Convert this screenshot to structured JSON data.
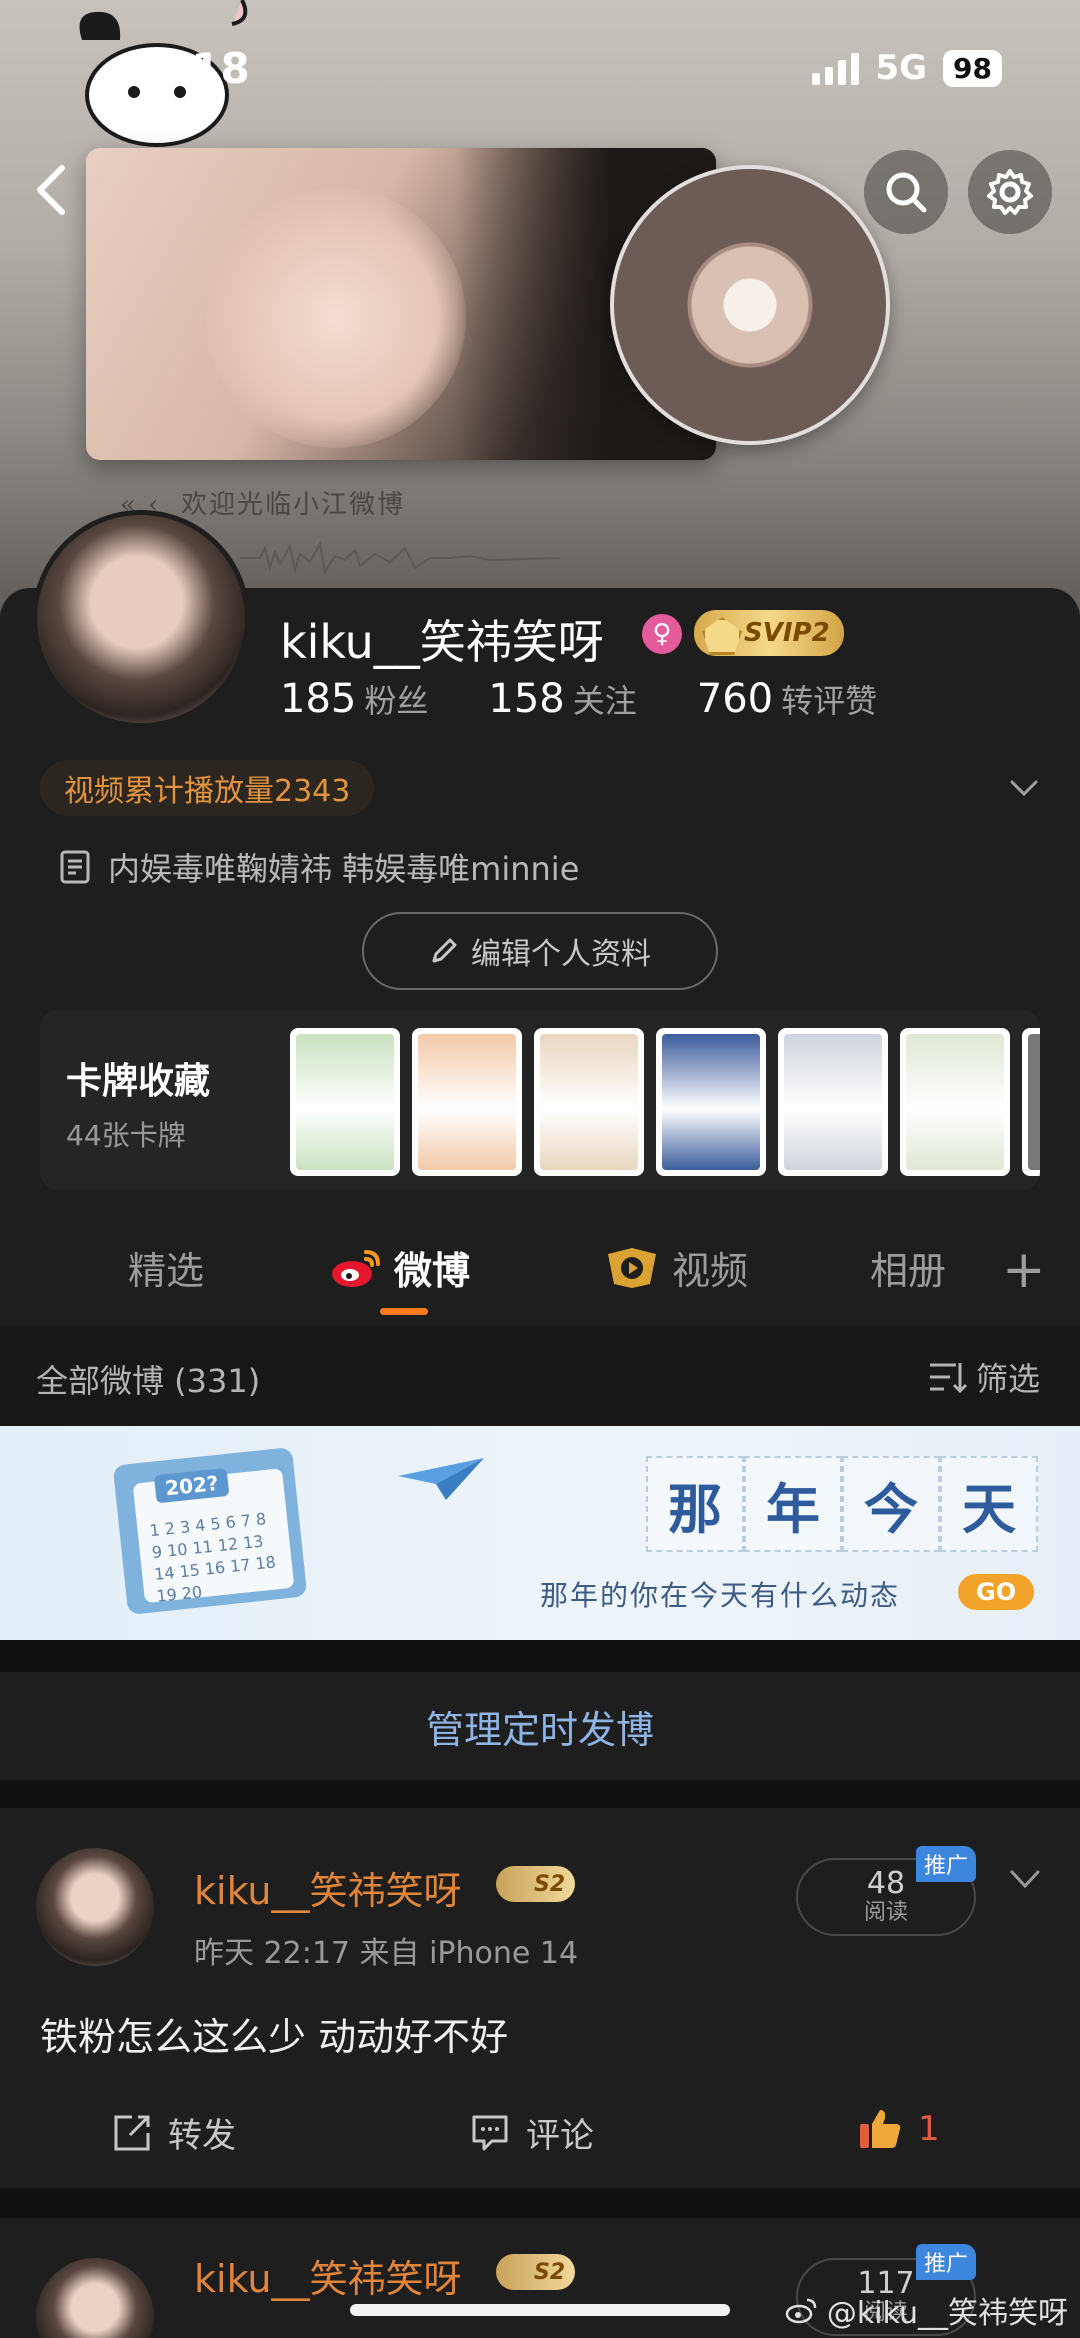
{
  "status_bar": {
    "time": "07:18",
    "network": "5G",
    "battery": "98"
  },
  "cover": {
    "welcome_text": "欢迎光临小江微博",
    "quote_mark": "« ‹"
  },
  "profile": {
    "username": "kiku__笑祎笑呀",
    "gender_symbol": "♀",
    "vip_badge": "SVIP2",
    "stats": [
      {
        "value": "185",
        "label": "粉丝"
      },
      {
        "value": "158",
        "label": "关注"
      },
      {
        "value": "760",
        "label": "转评赞"
      }
    ],
    "video_plays": "视频累计播放量2343",
    "bio": "内娱毒唯鞠婧祎 韩娱毒唯minnie",
    "edit_button": "编辑个人资料"
  },
  "cards": {
    "title": "卡牌收藏",
    "subtitle": "44张卡牌",
    "thumb_colors": [
      "#c9e2c0",
      "#f3c9a8",
      "#e9d6c0",
      "#3b5c9c",
      "#cfd4dc",
      "#dfe8d6"
    ]
  },
  "tabs": [
    {
      "label": "精选",
      "active": false
    },
    {
      "label": "微博",
      "active": true
    },
    {
      "label": "视频",
      "active": false
    },
    {
      "label": "相册",
      "active": false
    }
  ],
  "filter_bar": {
    "all_posts": "全部微博 (331)",
    "filter_label": "筛选"
  },
  "banner": {
    "year": "202?",
    "calendar_numbers": "1 2 3 4 5 6 7 8 9 10 11 12 13 14 15 16 17 18 19 20",
    "chars": [
      "那",
      "年",
      "今",
      "天"
    ],
    "tagline": "那年的你在今天有什么动态",
    "go": "GO"
  },
  "manage_scheduled": "管理定时发博",
  "posts": [
    {
      "name": "kiku__笑祎笑呀",
      "badge": "S2",
      "meta": "昨天 22:17  来自 iPhone 14",
      "reads": "48",
      "reads_label": "阅读",
      "promo": "推广",
      "text": "铁粉怎么这么少 动动好不好",
      "repost": "转发",
      "comment": "评论",
      "likes": "1"
    },
    {
      "name": "kiku__笑祎笑呀",
      "badge": "S2",
      "reads": "117",
      "reads_label": "阅读",
      "promo": "推广"
    }
  ],
  "watermark": "@kiku__笑祎笑呀"
}
